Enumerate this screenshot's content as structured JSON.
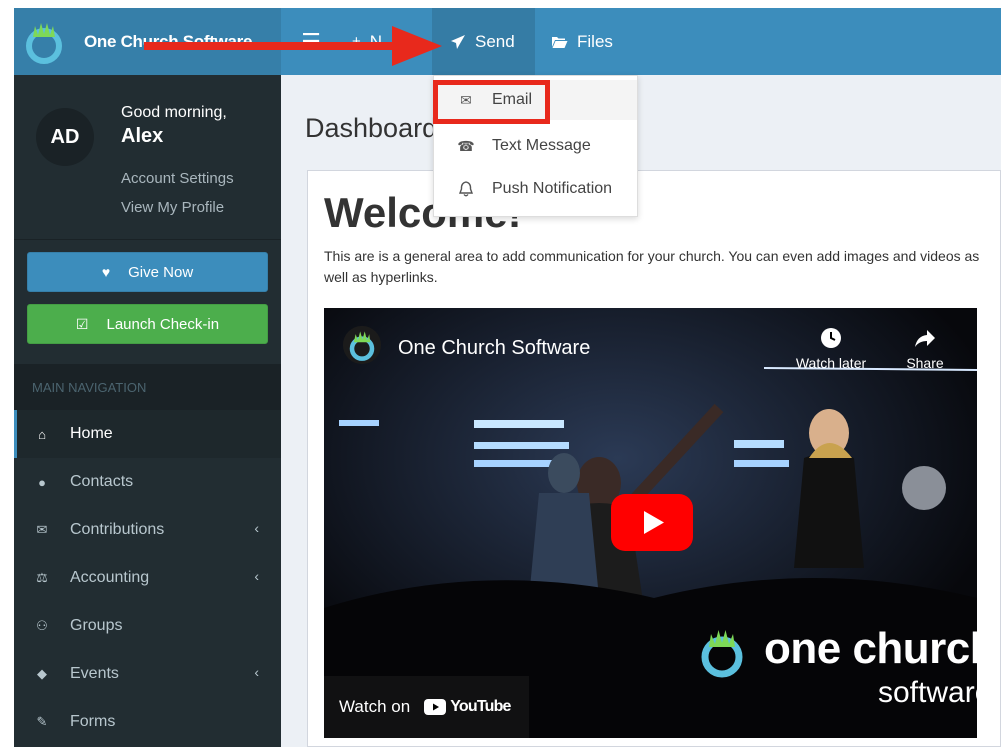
{
  "app": {
    "brand_name": "One Church Software"
  },
  "topbar": {
    "menu_icon": "hamburger-icon",
    "new_label": "N",
    "send_label": "Send",
    "files_label": "Files",
    "colors": {
      "bar": "#3c8dbc",
      "brand_bg": "#367fa9",
      "active": "#357ca5"
    }
  },
  "send_dropdown": {
    "items": [
      {
        "label": "Email",
        "icon": "envelope-icon",
        "highlighted": true
      },
      {
        "label": "Text Message",
        "icon": "phone-icon"
      },
      {
        "label": "Push Notification",
        "icon": "bell-icon"
      }
    ]
  },
  "annotation": {
    "arrow_color": "#e8291c",
    "highlight_color": "#e8291c"
  },
  "sidebar": {
    "avatar_initials": "AD",
    "greeting": "Good morning,",
    "user_name": "Alex",
    "account_settings": "Account Settings",
    "view_profile": "View My Profile",
    "give_now": "Give Now",
    "launch_checkin": "Launch Check-in",
    "nav_header": "MAIN NAVIGATION",
    "items": [
      {
        "label": "Home",
        "icon": "home-icon",
        "active": true
      },
      {
        "label": "Contacts",
        "icon": "user-icon"
      },
      {
        "label": "Contributions",
        "icon": "envelope-icon",
        "has_children": true
      },
      {
        "label": "Accounting",
        "icon": "balance-scale-icon",
        "has_children": true
      },
      {
        "label": "Groups",
        "icon": "users-icon"
      },
      {
        "label": "Events",
        "icon": "ticket-icon",
        "has_children": true
      },
      {
        "label": "Forms",
        "icon": "edit-icon"
      }
    ],
    "chevron": "‹"
  },
  "main": {
    "page_title": "Dashboard",
    "welcome_title": "Welcome!",
    "welcome_text": "This are is a general area to add communication for your church. You can even add images and videos as well as hyperlinks."
  },
  "video": {
    "title": "One Church Software",
    "watch_later": "Watch later",
    "share": "Share",
    "watch_on": "Watch on",
    "youtube": "YouTube",
    "watermark_line1": "one church",
    "watermark_line2": "software"
  }
}
